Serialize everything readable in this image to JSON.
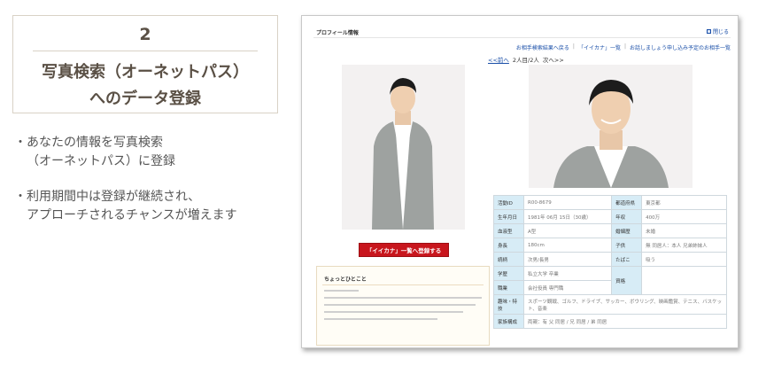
{
  "step": {
    "number": "2",
    "title_line1": "写真検索（オーネットパス）",
    "title_line2": "へのデータ登録"
  },
  "bullets": [
    {
      "mark": "・",
      "line1": "あなたの情報を写真検索",
      "line2": "（オーネットパス）に登録"
    },
    {
      "mark": "・",
      "line1": "利用期間中は登録が継続され、",
      "line2": "アプローチされるチャンスが増えます"
    }
  ],
  "screenshot": {
    "header_title": "プロフィール情報",
    "close_label": "閉じる",
    "close_icon": "square-icon",
    "nav_links": [
      "お相手検索結果へ戻る",
      "「イイカナ」一覧",
      "お話しましょう申し込み予定のお相手一覧"
    ],
    "nav_separator": "|",
    "pager": {
      "prev": "<<前へ",
      "position": "2人目/2人",
      "next": "次へ>>"
    },
    "register_button": "「イイカナ」一覧へ登録する",
    "hitokoto_title": "ちょっとひとこと",
    "table_rows": [
      {
        "k1": "活動ID",
        "v1": "R00-8679",
        "k2": "都道府県",
        "v2": "東京都"
      },
      {
        "k1": "生年月日",
        "v1": "1981年 06月 15日（30歳）",
        "k2": "年収",
        "v2": "400万"
      },
      {
        "k1": "血液型",
        "v1": "A型",
        "k2": "婚姻歴",
        "v2": "未婚"
      },
      {
        "k1": "身長",
        "v1": "180cm",
        "k2": "子供",
        "v2": "無 同居人：本人 兄弟姉妹人"
      },
      {
        "k1": "続柄",
        "v1": "次男/長男",
        "k2": "たばこ",
        "v2": "吸う"
      },
      {
        "k1": "学歴",
        "v1": "私立大学 卒業",
        "k2": "資格",
        "v2": ""
      },
      {
        "k1": "職業",
        "v1": "会社役員 専門職",
        "k2": "",
        "v2": ""
      },
      {
        "k1": "趣味・特技",
        "v1": "スポーツ観戦、ゴルフ、ドライブ、サッカー、ボウリング、映画鑑賞、テニス、バスケット、音楽",
        "k2": "",
        "v2": ""
      },
      {
        "k1": "家族構成",
        "v1": "両親：有 父 同居 / 兄 同居 / 弟 同居",
        "k2": "",
        "v2": ""
      }
    ]
  },
  "colors": {
    "accent_red": "#c8161d",
    "link_blue": "#1a4fa8",
    "table_key_bg": "#d7ecf6",
    "card_border": "#d9d2c6",
    "title_brown": "#5a5045"
  }
}
